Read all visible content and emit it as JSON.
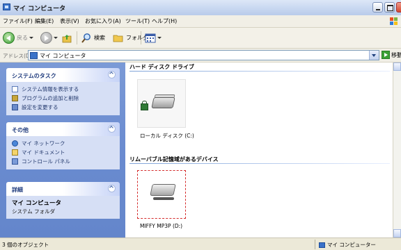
{
  "window": {
    "title": "マイ コンピュータ"
  },
  "menu": [
    "ファイル(F)",
    "編集(E)",
    "表示(V)",
    "お気に入り(A)",
    "ツール(T)",
    "ヘルプ(H)"
  ],
  "toolbar": {
    "back_label": "戻る",
    "search_label": "検索",
    "folders_label": "フォルダ"
  },
  "address": {
    "label": "アドレス(D)",
    "value": "マイ コンピュータ",
    "go_label": "移動"
  },
  "sidebar": {
    "system_tasks": {
      "title": "システムのタスク",
      "items": [
        "システム情報を表示する",
        "プログラムの追加と削除",
        "設定を変更する"
      ]
    },
    "other_places": {
      "title": "その他",
      "items": [
        "マイ ネットワーク",
        "マイ ドキュメント",
        "コントロール パネル"
      ]
    },
    "details": {
      "title": "詳細",
      "name": "マイ コンピュータ",
      "type": "システム フォルダ"
    }
  },
  "content": {
    "hard_drives": {
      "header": "ハード ディスク ドライブ",
      "items": [
        {
          "label": "ローカル ディスク (C:)"
        }
      ]
    },
    "removable": {
      "header": "リムーバブル記憶域があるデバイス",
      "items": [
        {
          "label": "MIFFY MP3P (D:)"
        }
      ]
    }
  },
  "status": {
    "left": "3 個のオブジェクト",
    "right": "マイ コンピューター"
  }
}
